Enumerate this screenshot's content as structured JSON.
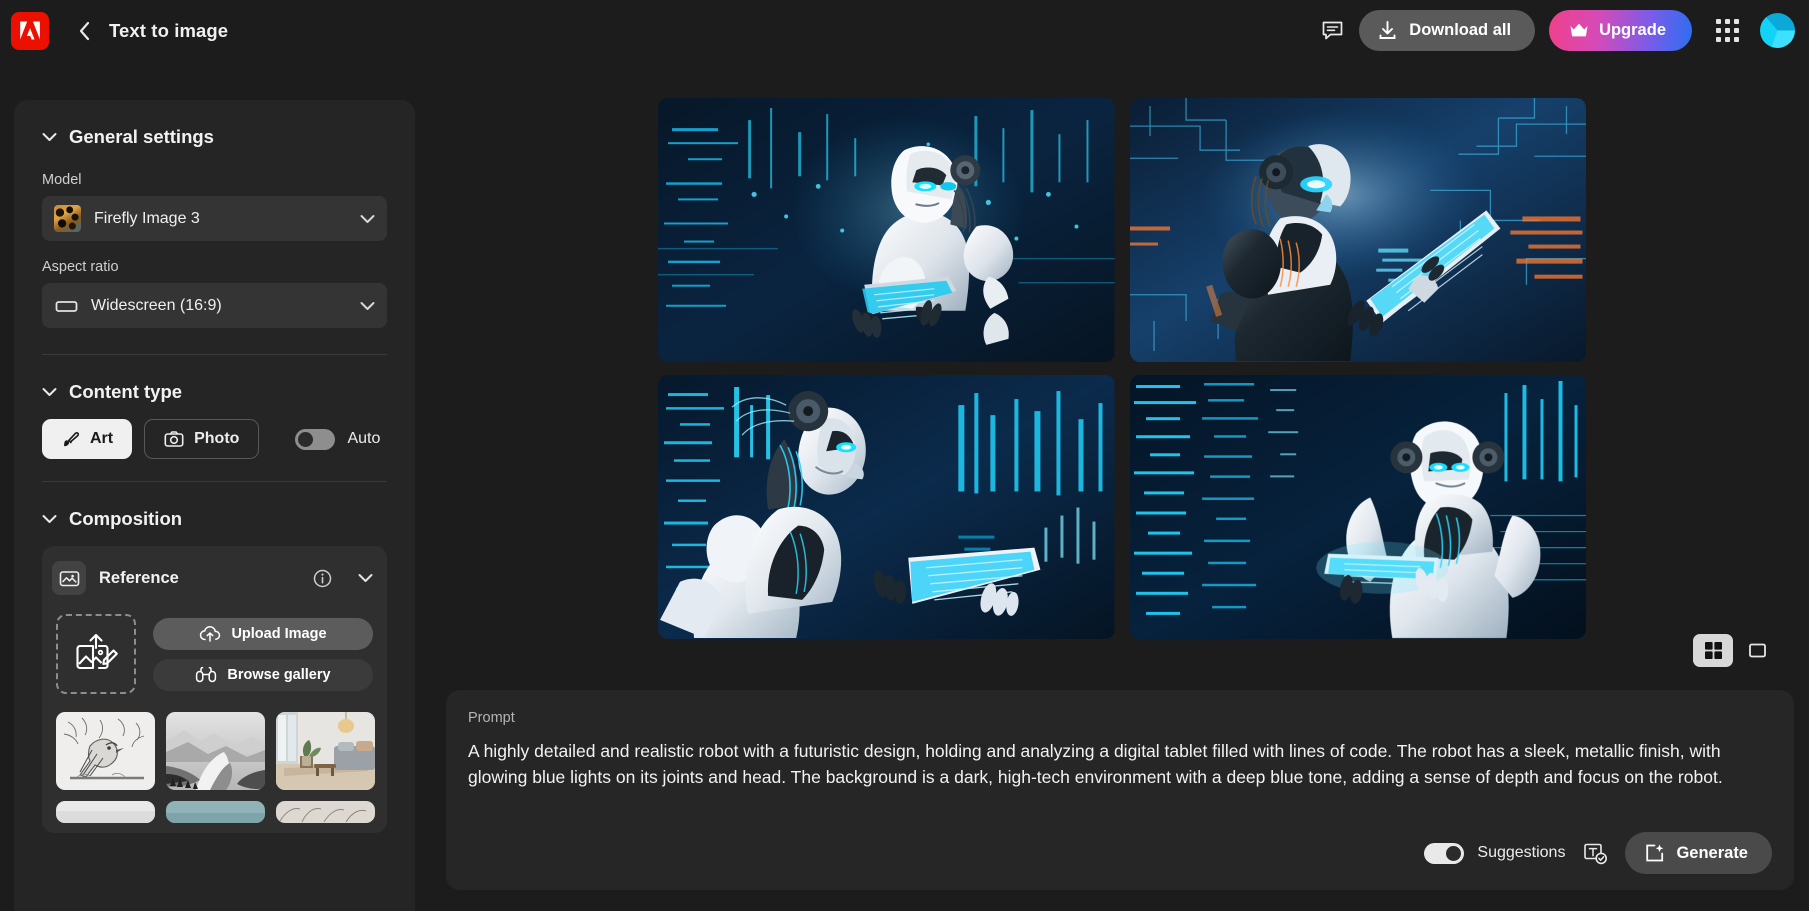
{
  "topbar": {
    "logo_icon": "adobe-logo-icon",
    "back_icon": "chevron-left-icon",
    "title": "Text to image",
    "chat_icon": "chat-bubble-icon",
    "download_icon": "download-icon",
    "download_label": "Download all",
    "upgrade_icon": "crown-icon",
    "upgrade_label": "Upgrade",
    "apps_icon": "apps-grid-icon",
    "avatar_icon": "user-avatar",
    "accent_upgrade_from": "#f0408a",
    "accent_upgrade_to": "#2b6ef0"
  },
  "sidebar": {
    "general": {
      "title": "General settings",
      "collapse_icon": "chevron-down-icon",
      "model_label": "Model",
      "model_value": "Firefly Image 3",
      "model_thumb_icon": "leopard-thumbnail",
      "model_chevron_icon": "chevron-down-icon",
      "aspect_label": "Aspect ratio",
      "aspect_value": "Widescreen (16:9)",
      "aspect_icon": "rectangle-widescreen-icon",
      "aspect_chevron_icon": "chevron-down-icon"
    },
    "content_type": {
      "title": "Content type",
      "collapse_icon": "chevron-down-icon",
      "art_label": "Art",
      "art_icon": "art-brush-icon",
      "photo_label": "Photo",
      "photo_icon": "camera-icon",
      "auto_label": "Auto",
      "auto_state": "off"
    },
    "composition": {
      "title": "Composition",
      "collapse_icon": "chevron-down-icon",
      "reference_label": "Reference",
      "reference_icon": "image-reference-icon",
      "info_icon": "info-circle-icon",
      "expand_icon": "chevron-down-icon",
      "dropzone_icon": "upload-image-placeholder-icon",
      "upload_label": "Upload Image",
      "upload_icon": "cloud-upload-icon",
      "browse_label": "Browse gallery",
      "browse_icon": "binoculars-icon",
      "thumbnails": [
        {
          "name": "sketch-bird-thumbnail"
        },
        {
          "name": "grayscale-mountains-thumbnail"
        },
        {
          "name": "living-room-thumbnail"
        },
        {
          "name": "light-thumbnail-partial"
        },
        {
          "name": "teal-thumbnail-partial"
        },
        {
          "name": "texture-thumbnail-partial"
        }
      ]
    }
  },
  "results": {
    "images": [
      {
        "name": "generated-image-1",
        "alt": "white humanoid robot holding glowing tablet"
      },
      {
        "name": "generated-image-2",
        "alt": "dark robot with orange accents holding tablet"
      },
      {
        "name": "generated-image-3",
        "alt": "white robot reading tablet in blue data room"
      },
      {
        "name": "generated-image-4",
        "alt": "robot facing viewer holding bright tablet"
      }
    ],
    "view_grid_icon": "grid-view-icon",
    "view_single_icon": "single-view-icon",
    "view_selected": "grid"
  },
  "prompt": {
    "label": "Prompt",
    "text": "A highly detailed and realistic robot with a futuristic design, holding and analyzing a digital tablet filled with lines of code. The robot has a sleek, metallic finish, with glowing blue lights on its joints and head. The background is a dark, high-tech environment with a deep blue tone, adding a sense of depth and focus on the robot.",
    "suggestions_label": "Suggestions",
    "suggestions_state": "on",
    "spellcheck_icon": "text-check-icon",
    "generate_label": "Generate",
    "generate_icon": "sparkle-generate-icon"
  }
}
